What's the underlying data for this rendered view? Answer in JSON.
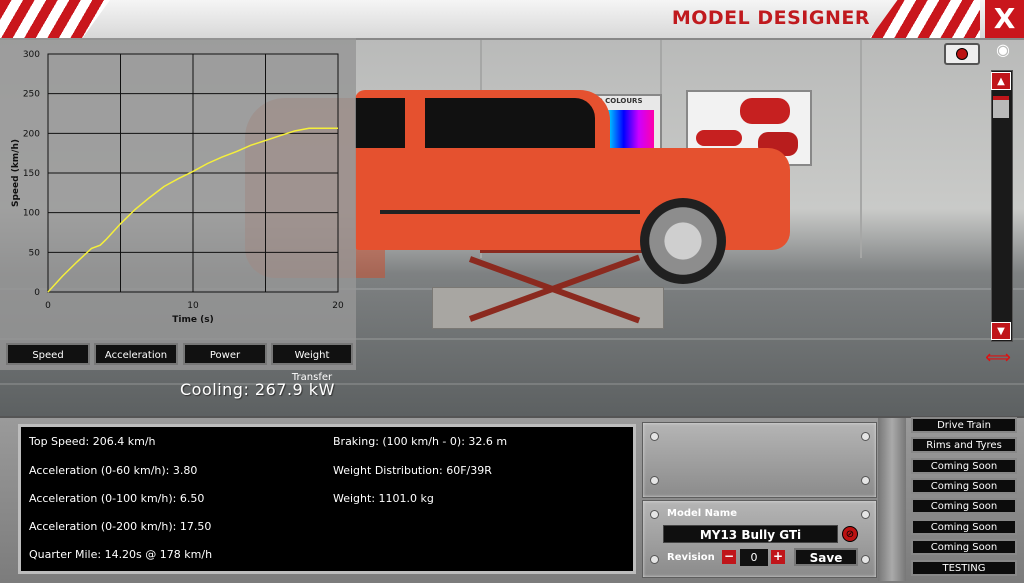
{
  "window": {
    "title": "MODEL DESIGNER",
    "close_label": "X"
  },
  "colors": {
    "accent_red": "#c9161c",
    "car_orange": "#e5512f",
    "line_yellow": "#f5ef3b"
  },
  "chart_tabs": [
    "Speed",
    "Acceleration",
    "Power",
    "Weight Transfer"
  ],
  "cooling": "Cooling: 267.9 kW",
  "chart_data": {
    "type": "line",
    "xlabel": "Time (s)",
    "ylabel": "Speed (km/h)",
    "xlim": [
      0,
      20
    ],
    "ylim": [
      0,
      300
    ],
    "x_ticks": [
      "0",
      "10",
      "20"
    ],
    "y_ticks": [
      "0",
      "50",
      "100",
      "150",
      "200",
      "250",
      "300"
    ],
    "grid": true,
    "series": [
      {
        "x": [
          0,
          1,
          2,
          3,
          3.6,
          4,
          5,
          6,
          7,
          8,
          9,
          10,
          11,
          12,
          13,
          14,
          15,
          16,
          17,
          18,
          19,
          20
        ],
        "y": [
          0,
          20,
          38,
          55,
          59,
          66,
          86,
          104,
          119,
          133,
          143,
          152,
          162,
          170,
          177,
          185,
          191,
          197,
          203,
          206.4,
          206.4,
          206.4
        ]
      }
    ]
  },
  "stats": {
    "top_speed": "Top Speed: 206.4 km/h",
    "accel_0_60": "Acceleration (0-60 km/h): 3.80",
    "accel_0_100": "Acceleration (0-100 km/h): 6.50",
    "accel_0_200": "Acceleration (0-200 km/h): 17.50",
    "quarter_mile": "Quarter Mile: 14.20s @ 178 km/h",
    "braking": "Braking: (100 km/h - 0): 32.6 m",
    "weight_distribution": "Weight Distribution: 60F/39R",
    "weight": "Weight: 1101.0 kg"
  },
  "model": {
    "name_label": "Model Name",
    "name_value": "MY13 Bully GTi",
    "revision_label": "Revision",
    "revision_value": "0",
    "minus": "−",
    "plus": "+",
    "save_label": "Save"
  },
  "side_menu": [
    "Drive Train",
    "Rims and Tyres",
    "Coming Soon",
    "Coming Soon",
    "Coming Soon",
    "Coming Soon",
    "Coming Soon",
    "TESTING"
  ],
  "icons": {
    "camera": "camera-icon",
    "eye": "eye-icon",
    "rotate": "rotate-icon"
  },
  "poster_text": "PROPOSED COLOURS"
}
